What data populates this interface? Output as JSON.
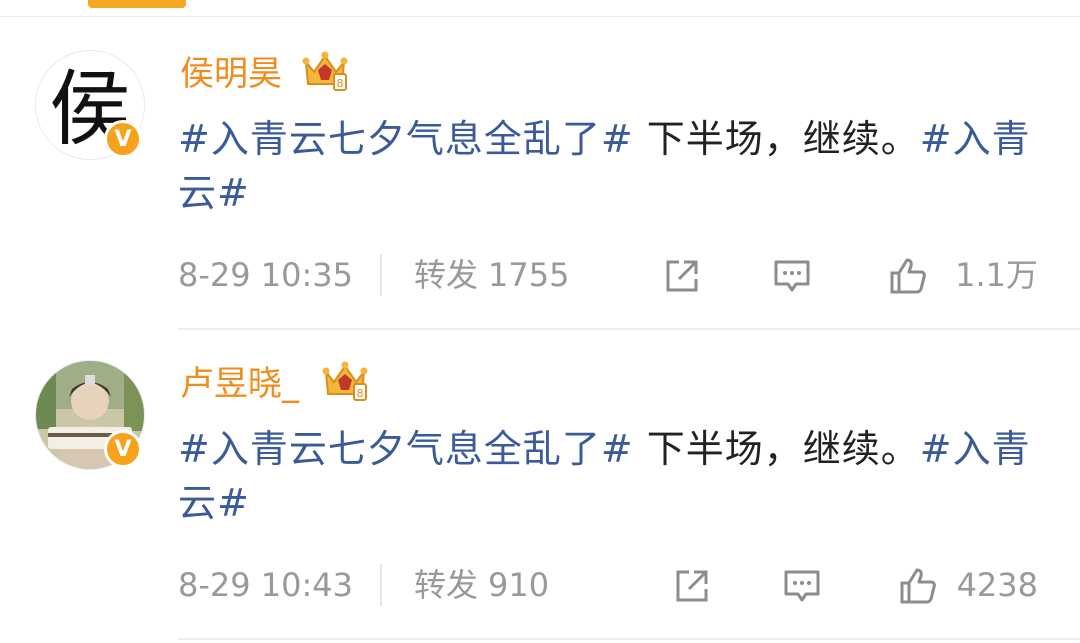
{
  "posts": [
    {
      "author": "侯明昊",
      "text_segments": [
        {
          "kind": "hashtag",
          "text": "#入青云七夕气息全乱了#"
        },
        {
          "kind": "plain",
          "text": " 下半场，继续。"
        },
        {
          "kind": "hashtag",
          "text": "#入青云#"
        }
      ],
      "timestamp": "8-29 10:35",
      "repost_label": "转发",
      "repost_count": "1755",
      "like_count": "1.1万",
      "avatar_char": "侯",
      "verified_mark": "V"
    },
    {
      "author": "卢昱晓_",
      "text_segments": [
        {
          "kind": "hashtag",
          "text": "#入青云七夕气息全乱了#"
        },
        {
          "kind": "plain",
          "text": " 下半场，继续。"
        },
        {
          "kind": "hashtag",
          "text": "#入青云#"
        }
      ],
      "timestamp": "8-29 10:43",
      "repost_label": "转发",
      "repost_count": "910",
      "like_count": "4238",
      "verified_mark": "V"
    }
  ],
  "icons": [
    "share-icon",
    "comment-icon",
    "like-icon",
    "crown-badge-icon"
  ],
  "colors": {
    "username": "#f08c1e",
    "hashtag": "#3a5a9a",
    "meta": "#999999",
    "badge": "#f7a21b"
  }
}
